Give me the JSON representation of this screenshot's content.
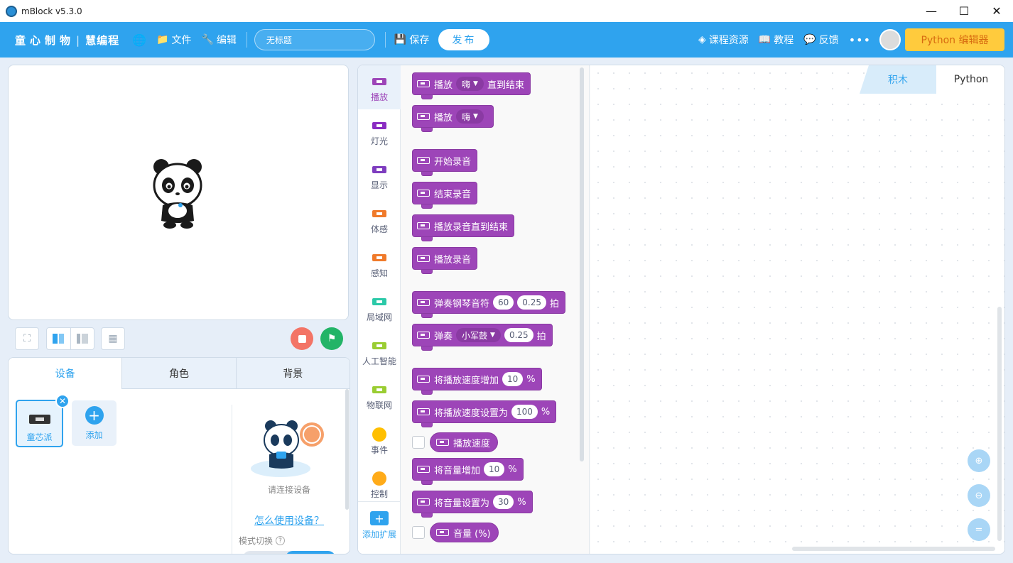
{
  "window": {
    "title": "mBlock v5.3.0",
    "minimize": "—",
    "maximize": "☐",
    "close": "✕"
  },
  "header": {
    "brand_main": "童心制物",
    "brand_sep": "|",
    "brand_sub": "慧编程",
    "menu_file": "文件",
    "menu_edit": "编辑",
    "project_title": "无标题",
    "save": "保存",
    "publish": "发布",
    "courses": "课程资源",
    "tutorials": "教程",
    "feedback": "反馈",
    "more": "•••",
    "python_editor": "Python 编辑器"
  },
  "device_panel": {
    "tabs": [
      "设备",
      "角色",
      "背景"
    ],
    "active_tab": 0,
    "device_name": "童芯派",
    "add_label": "添加",
    "connect_prompt": "请连接设备",
    "howto_link": "怎么使用设备？",
    "mode_switch": "模式切换"
  },
  "categories": [
    {
      "label": "播放",
      "color": "#9d45b8"
    },
    {
      "label": "灯光",
      "color": "#8a2cc2"
    },
    {
      "label": "显示",
      "color": "#7e3dbf"
    },
    {
      "label": "体感",
      "color": "#f07a2a"
    },
    {
      "label": "感知",
      "color": "#f07a2a"
    },
    {
      "label": "局域网",
      "color": "#2bc9a8"
    },
    {
      "label": "人工智能",
      "color": "#9acd32"
    },
    {
      "label": "物联网",
      "color": "#9acd32"
    },
    {
      "label": "事件",
      "color": "#ffbf00"
    },
    {
      "label": "控制",
      "color": "#ffab19"
    }
  ],
  "add_extension": "添加扩展",
  "blocks": {
    "play_until_done": {
      "pre": "播放",
      "sound": "嗨",
      "post": "直到结束"
    },
    "play": {
      "pre": "播放",
      "sound": "嗨"
    },
    "start_record": "开始录音",
    "stop_record": "结束录音",
    "play_record_until_done": "播放录音直到结束",
    "play_record": "播放录音",
    "play_piano": {
      "pre": "弹奏钢琴音符",
      "note": "60",
      "beats": "0.25",
      "post": "拍"
    },
    "play_drum": {
      "pre": "弹奏",
      "drum": "小军鼓",
      "beats": "0.25",
      "post": "拍"
    },
    "change_speed": {
      "pre": "将播放速度增加",
      "value": "10",
      "post": "%"
    },
    "set_speed": {
      "pre": "将播放速度设置为",
      "value": "100",
      "post": "%"
    },
    "speed_reporter": "播放速度",
    "change_volume": {
      "pre": "将音量增加",
      "value": "10",
      "post": "%"
    },
    "set_volume": {
      "pre": "将音量设置为",
      "value": "30",
      "post": "%"
    },
    "volume_reporter": "音量 (%)"
  },
  "workspace": {
    "tab_blocks": "积木",
    "tab_python": "Python"
  },
  "colors": {
    "accent": "#2fa3ee",
    "sound_block": "#9d45b8",
    "python_button": "#ffcb3d"
  }
}
